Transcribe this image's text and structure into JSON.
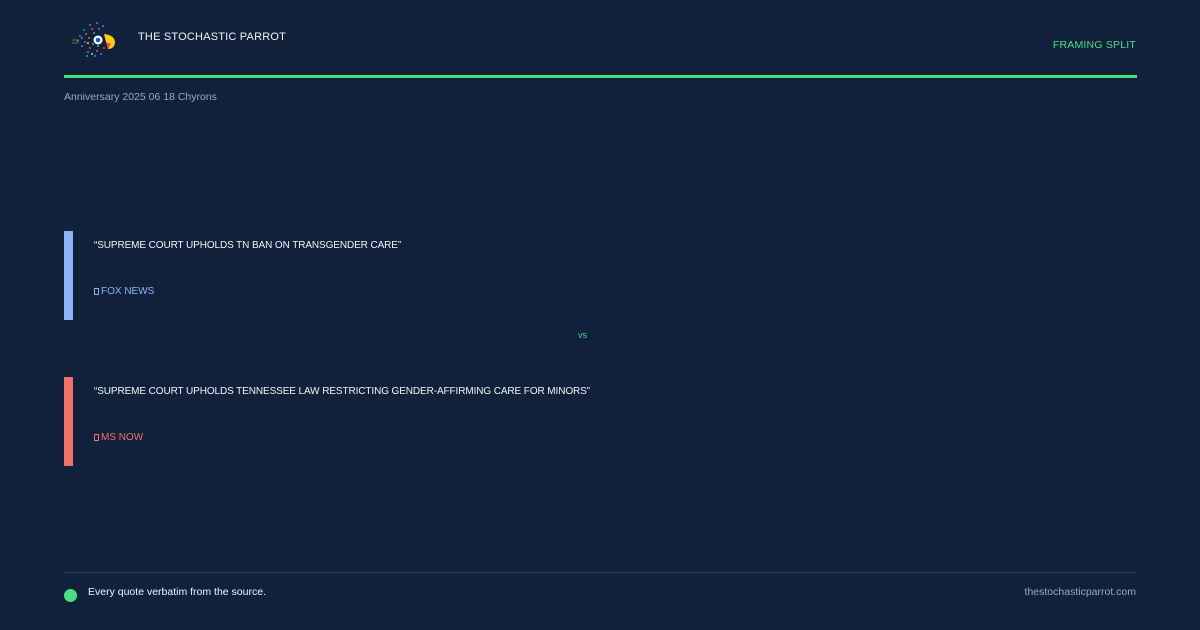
{
  "header": {
    "logo_icon": "parrot-logo-icon",
    "brand": "THE STOCHASTIC PARROT",
    "tag": "FRAMING SPLIT",
    "subtitle": "Anniversary 2025 06 18 Chyrons"
  },
  "quotes": [
    {
      "text": "“SUPREME COURT UPHOLDS TN BAN ON TRANSGENDER CARE”",
      "source": "FOX NEWS",
      "color": "#8ab4f8"
    },
    {
      "text": "“SUPREME COURT UPHOLDS TENNESSEE LAW RESTRICTING GENDER-AFFIRMING CARE FOR MINORS”",
      "source": "MS NOW",
      "color": "#f07167"
    }
  ],
  "divider": {
    "label": "vs"
  },
  "footer": {
    "note": "Every quote verbatim from the source.",
    "site": "thestochasticparrot.com"
  },
  "colors": {
    "background": "#12213b",
    "accent": "#4ade80"
  }
}
